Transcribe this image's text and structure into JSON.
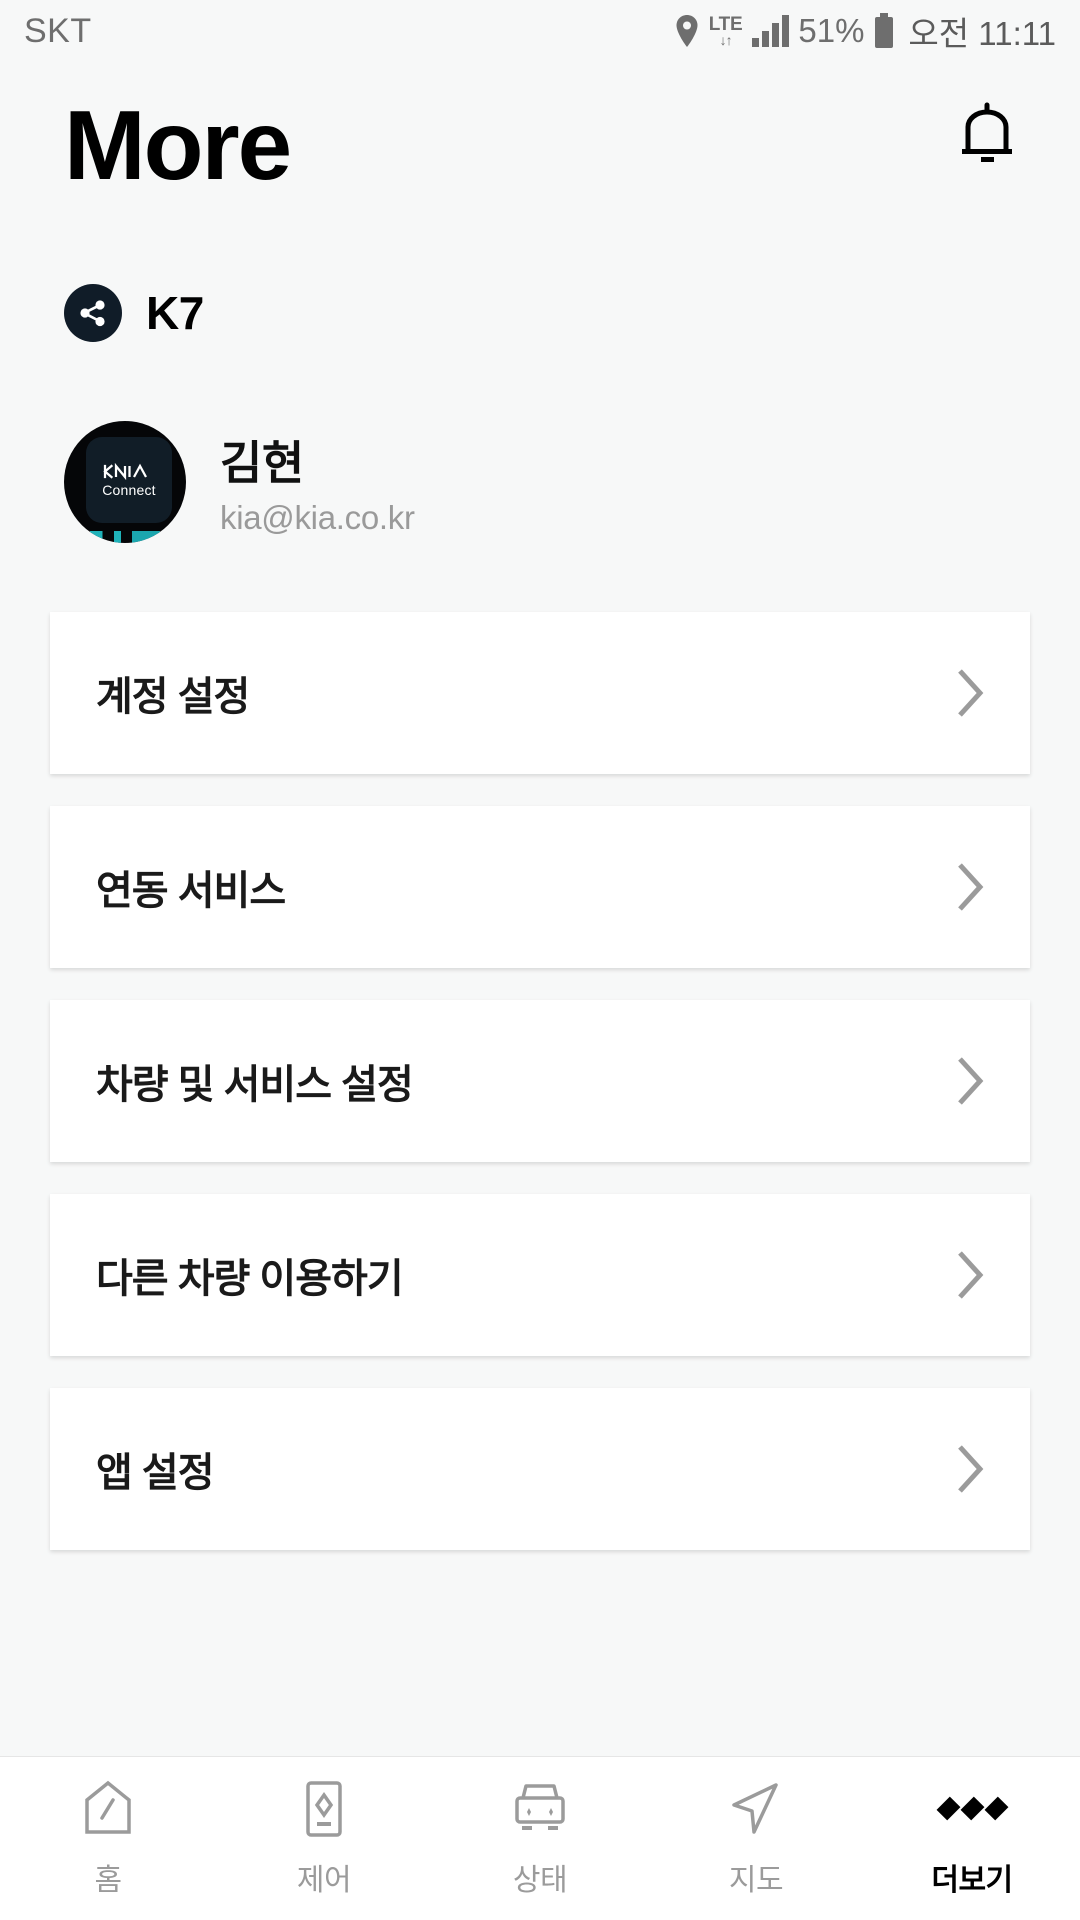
{
  "status_bar": {
    "carrier": "SKT",
    "network": "LTE",
    "network_arrows": "↓↑",
    "battery_percent": "51%",
    "time": "오전 11:11",
    "icons": [
      "location-pin-icon",
      "lte-icon",
      "signal-bars-icon",
      "battery-icon"
    ]
  },
  "header": {
    "title": "More",
    "notification_icon": "bell-icon"
  },
  "vehicle": {
    "badge_icon": "share-icon",
    "name": "K7"
  },
  "profile": {
    "avatar_icon": "kia-connect-logo",
    "avatar_brand": "KIA",
    "avatar_sub": "Connect",
    "name": "김현",
    "email": "kia@kia.co.kr"
  },
  "menu": {
    "items": [
      {
        "label": "계정 설정",
        "chevron": "chevron-right-icon"
      },
      {
        "label": "연동 서비스",
        "chevron": "chevron-right-icon"
      },
      {
        "label": "차량 및 서비스 설정",
        "chevron": "chevron-right-icon"
      },
      {
        "label": "다른 차량 이용하기",
        "chevron": "chevron-right-icon"
      },
      {
        "label": "앱 설정",
        "chevron": "chevron-right-icon"
      }
    ]
  },
  "bottom_nav": {
    "items": [
      {
        "label": "홈",
        "icon": "home-icon",
        "active": false
      },
      {
        "label": "제어",
        "icon": "control-icon",
        "active": false
      },
      {
        "label": "상태",
        "icon": "car-front-icon",
        "active": false
      },
      {
        "label": "지도",
        "icon": "navigate-icon",
        "active": false
      },
      {
        "label": "더보기",
        "icon": "more-dots-icon",
        "active": true
      }
    ]
  },
  "colors": {
    "background": "#f7f8f8",
    "card": "#ffffff",
    "badge_dark": "#101c28",
    "text_primary": "#111111",
    "text_muted": "#9a9a9a",
    "nav_inactive": "#9b9b9b",
    "accent_teal": "#24d0d8"
  }
}
